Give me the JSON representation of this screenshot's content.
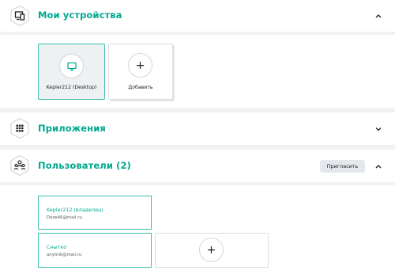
{
  "sections": {
    "devices": {
      "title": "Мои устройства",
      "expanded": true,
      "icon": "devices-icon",
      "items": [
        {
          "label": "Kepler212 (Desktop)",
          "icon": "desktop-icon",
          "selected": true
        }
      ],
      "add_label": "Добавить"
    },
    "apps": {
      "title": "Приложения",
      "expanded": false,
      "icon": "apps-grid-icon"
    },
    "users": {
      "title": "Пользователи (2)",
      "expanded": true,
      "icon": "users-icon",
      "invite_label": "Пригласить",
      "items": [
        {
          "name": "Kepler212 (владелец)",
          "email": "Doze46@mail.ru"
        },
        {
          "name": "Снытко",
          "email": "anytnik@mail.ru"
        }
      ]
    }
  },
  "colors": {
    "accent": "#00a88e",
    "card_border": "#3cc1aa",
    "background": "#f1f2f4"
  }
}
